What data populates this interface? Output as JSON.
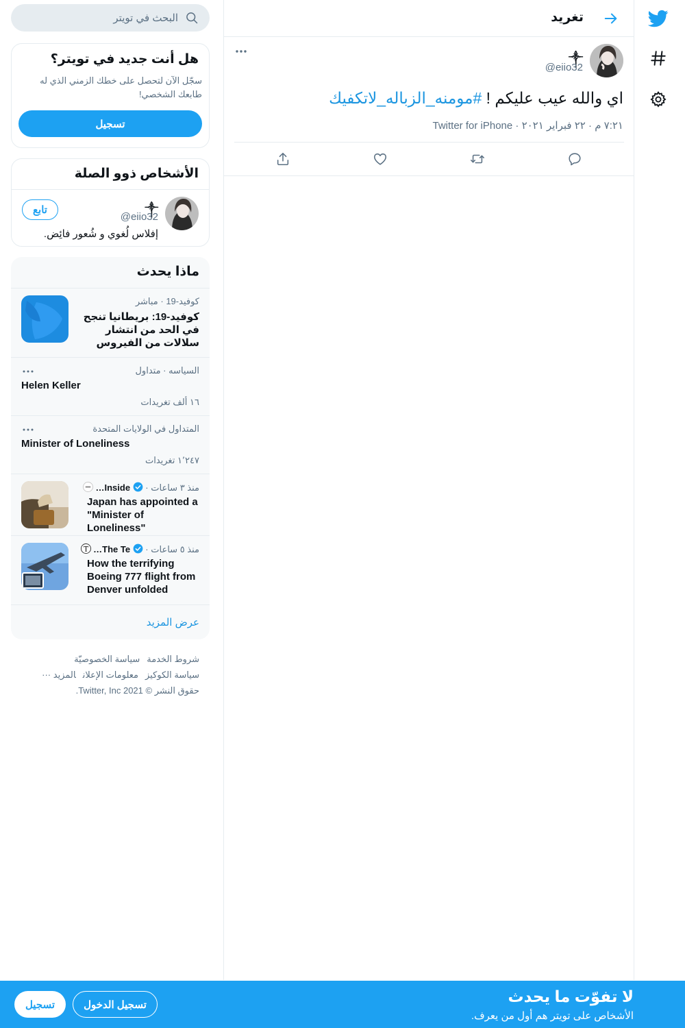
{
  "colors": {
    "accent": "#1da1f2",
    "link": "#1b95e0",
    "secondary_text": "#5b7083",
    "border": "#e6ecf0",
    "trends_bg": "#f7f9fa"
  },
  "icons": {
    "rail": [
      "twitter-bird-icon",
      "hashtag-icon",
      "gear-icon"
    ],
    "header": "arrow-icon",
    "actions": [
      "reply-icon",
      "retweet-icon",
      "like-icon",
      "share-icon"
    ],
    "search": "search-icon"
  },
  "header": {
    "title": "تغريد"
  },
  "tweet": {
    "name": "༒",
    "handle": "@eiio32",
    "text": "اي والله عيب عليكم ! ",
    "hashtag": "#مومنه_الزباله_لاتكفيك",
    "meta": "٧:٢١ م · ٢٢ فبراير ٢٠٢١ · Twitter for iPhone"
  },
  "search": {
    "placeholder": "البحث في تويتر"
  },
  "new_to_twitter": {
    "title": "هل أنت جديد في تويتر؟",
    "description": "سجّل الآن لتحصل على خطك الزمني الذي له طابعك الشخصي!",
    "signup_label": "تسجيل"
  },
  "relevant_people": {
    "title": "الأشخاص ذوو الصلة",
    "person": {
      "name": "༒",
      "handle": "@eiio32",
      "bio": "إفلاس لُغوي و شُعور فائِض.",
      "follow_label": "تابع"
    }
  },
  "trends": {
    "title": "ماذا يحدث",
    "items": [
      {
        "meta": "كوفيد-19 · مباشر",
        "name": "كوفيد-19: بريطانيا تنجح في الحد من انتشار سلالات من الفيروس"
      },
      {
        "meta": "السياسه · متداول",
        "name": "Helen Keller",
        "count": "١٦ ألف تغريدات"
      },
      {
        "meta": "المتداول في الولايات المتحدة",
        "name": "Minister of Loneliness",
        "count": "١٬٢٤٧ تغريدات"
      },
      {
        "source": "Inside…",
        "time": "منذ ٣ ساعات",
        "name": "Japan has appointed a \"Minister of Loneliness\""
      },
      {
        "source": "The Te…",
        "time": "منذ ٥ ساعات",
        "name": "How the terrifying Boeing 777 flight from Denver unfolded"
      }
    ],
    "show_more": "عرض المزيد"
  },
  "footer": {
    "links": [
      "شروط الخدمة",
      "سياسة الخصوصيّة",
      "سياسة الكوكيز",
      "معلومات الإعلان",
      "المزيد ···"
    ],
    "copyright": "حقوق النشر © 2021 Twitter, Inc."
  },
  "bottom_bar": {
    "title": "لا تفوّت ما يحدث",
    "subtitle": "الأشخاص على تويتر هم أول من يعرف.",
    "login_label": "تسجيل الدخول",
    "signup_label": "تسجيل"
  }
}
